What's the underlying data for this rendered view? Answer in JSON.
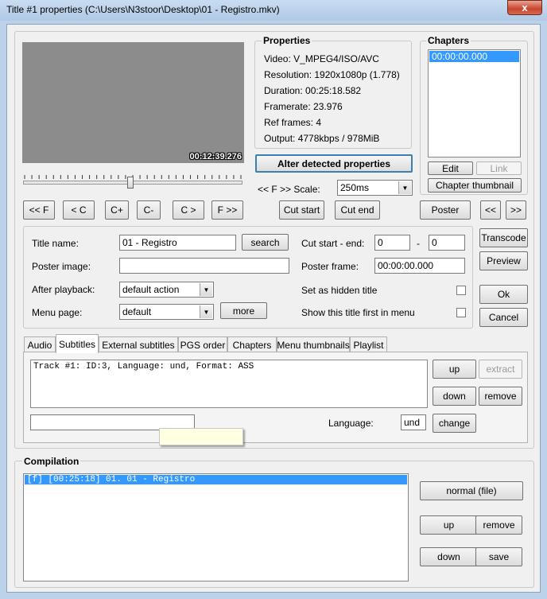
{
  "window": {
    "title": "Title #1 properties (C:\\Users\\N3stoor\\Desktop\\01 - Registro.mkv)",
    "close": "x"
  },
  "preview": {
    "timestamp": "00:12:39.276",
    "seek_fraction": 0.49
  },
  "properties": {
    "title": "Properties",
    "video": "Video: V_MPEG4/ISO/AVC",
    "resolution": "Resolution: 1920x1080p (1.778)",
    "duration": "Duration: 00:25:18.582",
    "framerate": "Framerate: 23.976",
    "ref_frames": "Ref frames: 4",
    "output": "Output: 4778kbps / 978MiB"
  },
  "alter_button": "Alter detected properties",
  "scale": {
    "label": "<< F >> Scale:",
    "value": "250ms"
  },
  "chapters": {
    "title": "Chapters",
    "items": [
      "00:00:00.000"
    ],
    "edit": "Edit",
    "link": "Link",
    "thumbnail": "Chapter thumbnail"
  },
  "nav": {
    "ff_back": "<< F",
    "c_back": "< C",
    "c_plus": "C+",
    "c_minus": "C-",
    "c_fwd": "C >",
    "ff_fwd": "F >>",
    "cut_start": "Cut start",
    "cut_end": "Cut end",
    "poster": "Poster",
    "prev": "<<",
    "next": ">>"
  },
  "form": {
    "title_name_label": "Title name:",
    "title_name_value": "01 - Registro",
    "search": "search",
    "poster_image_label": "Poster image:",
    "poster_image_value": "",
    "after_playback_label": "After playback:",
    "after_playback_value": "default action",
    "menu_page_label": "Menu page:",
    "menu_page_value": "default",
    "more": "more",
    "cut_label": "Cut start - end:",
    "cut_start_value": "0",
    "cut_dash": "-",
    "cut_end_value": "0",
    "poster_frame_label": "Poster frame:",
    "poster_frame_value": "00:00:00.000",
    "hidden_label": "Set as hidden title",
    "first_label": "Show this title first in menu"
  },
  "side_buttons": {
    "transcode": "Transcode",
    "preview": "Preview",
    "ok": "Ok",
    "cancel": "Cancel"
  },
  "tabs": [
    "Audio",
    "Subtitles",
    "External subtitles",
    "PGS order",
    "Chapters",
    "Menu thumbnails",
    "Playlist"
  ],
  "subtitles": {
    "tracks": [
      "Track #1: ID:3, Language: und, Format: ASS"
    ],
    "up": "up",
    "extract": "extract",
    "down": "down",
    "remove": "remove",
    "name_value": "",
    "language_label": "Language:",
    "language_value": "und",
    "change": "change"
  },
  "compilation": {
    "title": "Compilation",
    "items": [
      "[f] [00:25:18] 01. 01 - Registro"
    ],
    "normal": "normal (file)",
    "up": "up",
    "remove": "remove",
    "down": "down",
    "save": "save"
  }
}
